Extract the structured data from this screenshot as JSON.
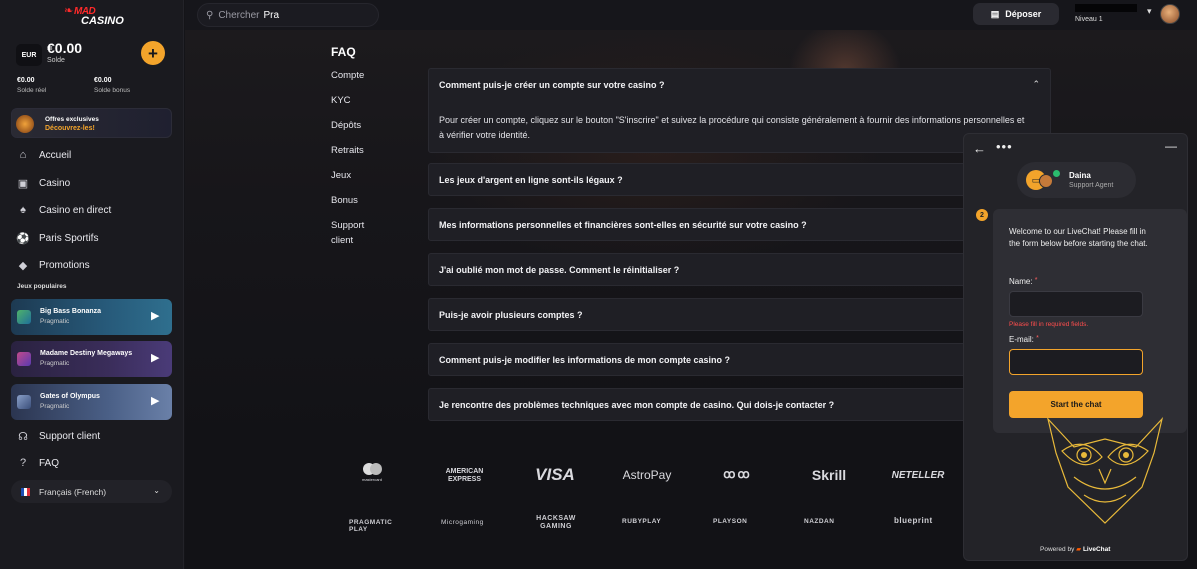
{
  "header": {
    "search_placeholder": "Chercher",
    "search_value": "Pra",
    "deposit_label": "Déposer",
    "user_level": "Niveau 1"
  },
  "sidebar": {
    "logo_line1": "MAD",
    "logo_line2": "CASINO",
    "currency": "EUR",
    "balance": "€0.00",
    "balance_label": "Solde",
    "real_value": "€0.00",
    "real_label": "Solde réel",
    "bonus_value": "€0.00",
    "bonus_label": "Solde bonus",
    "offers_title": "Offres exclusives",
    "offers_cta": "Découvrez-les!",
    "nav": [
      {
        "label": "Accueil",
        "icon": "home-icon"
      },
      {
        "label": "Casino",
        "icon": "slot-icon"
      },
      {
        "label": "Casino en direct",
        "icon": "cards-icon"
      },
      {
        "label": "Paris Sportifs",
        "icon": "soccer-icon"
      },
      {
        "label": "Promotions",
        "icon": "diamond-icon"
      }
    ],
    "popular_title": "Jeux populaires",
    "games": [
      {
        "name": "Big Bass Bonanza",
        "provider": "Pragmatic"
      },
      {
        "name": "Madame Destiny Megaways",
        "provider": "Pragmatic"
      },
      {
        "name": "Gates of Olympus",
        "provider": "Pragmatic"
      }
    ],
    "support_label": "Support client",
    "faq_label": "FAQ",
    "language": "Français (French)"
  },
  "faq": {
    "title": "FAQ",
    "categories": [
      "Compte",
      "KYC",
      "Dépôts",
      "Retraits",
      "Jeux",
      "Bonus",
      "Support client"
    ],
    "items": [
      {
        "q": "Comment puis-je créer un compte sur votre casino ?",
        "a": "Pour créer un compte, cliquez sur le bouton \"S'inscrire\" et suivez la procédure qui consiste généralement à fournir des informations personnelles et à vérifier votre identité."
      },
      {
        "q": "Les jeux d'argent en ligne sont-ils légaux ?"
      },
      {
        "q": "Mes informations personnelles et financières sont-elles en sécurité sur votre casino ?"
      },
      {
        "q": "J'ai oublié mon mot de passe. Comment le réinitialiser ?"
      },
      {
        "q": "Puis-je avoir plusieurs comptes ?"
      },
      {
        "q": "Comment puis-je modifier les informations de mon compte casino ?"
      },
      {
        "q": "Je rencontre des problèmes techniques avec mon compte de casino. Qui dois-je contacter ?"
      }
    ]
  },
  "payments": [
    "mastercard",
    "AMERICAN EXPRESS",
    "VISA",
    "AstroPay",
    "ꝏꝏ",
    "Skrill",
    "NETELLER"
  ],
  "providers": [
    "PRAGMATIC PLAY",
    "Microgaming",
    "HACKSAW GAMING",
    "RUBYPLAY",
    "PLAYSON",
    "NAZDAN",
    "blueprint"
  ],
  "chat": {
    "agent_name": "Daina",
    "agent_role": "Support Agent",
    "badge": "2",
    "welcome": "Welcome to our LiveChat! Please fill in the form below before starting the chat.",
    "name_label": "Name:",
    "name_error": "Please fill in required fields.",
    "email_label": "E-mail:",
    "start_label": "Start the chat",
    "powered_prefix": "Powered by",
    "powered_brand": "LiveChat",
    "required_mark": "*"
  }
}
